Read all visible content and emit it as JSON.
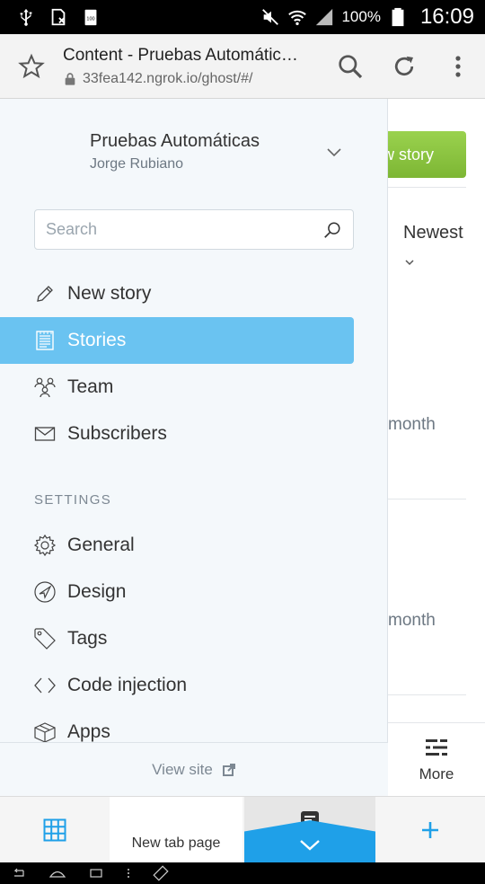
{
  "status_bar": {
    "battery_percent": "100%",
    "time": "16:09"
  },
  "browser": {
    "page_title": "Content - Pruebas Automáticas - Ghost",
    "url": "33fea142.ngrok.io/ghost/#/"
  },
  "background_page": {
    "new_story_button": "w story",
    "sort_label": "Newest",
    "ago_1": "month",
    "ago_2": "month",
    "more_label": "More"
  },
  "drawer": {
    "site_title": "Pruebas Automáticas",
    "site_user": "Jorge Rubiano",
    "search_placeholder": "Search",
    "nav": [
      {
        "label": "New story",
        "icon": "pencil-icon"
      },
      {
        "label": "Stories",
        "icon": "stories-icon",
        "active": true
      },
      {
        "label": "Team",
        "icon": "team-icon"
      },
      {
        "label": "Subscribers",
        "icon": "envelope-icon"
      }
    ],
    "settings_label": "SETTINGS",
    "settings": [
      {
        "label": "General",
        "icon": "gear-icon"
      },
      {
        "label": "Design",
        "icon": "compass-icon"
      },
      {
        "label": "Tags",
        "icon": "tag-icon"
      },
      {
        "label": "Code injection",
        "icon": "code-icon"
      },
      {
        "label": "Apps",
        "icon": "box-icon"
      }
    ],
    "view_site_label": "View site"
  },
  "tab_strip": {
    "new_tab_label": "New tab page"
  },
  "colors": {
    "accent": "#6ac3f1",
    "green": "#8cc63f",
    "tab_blue": "#1fa0e8"
  }
}
